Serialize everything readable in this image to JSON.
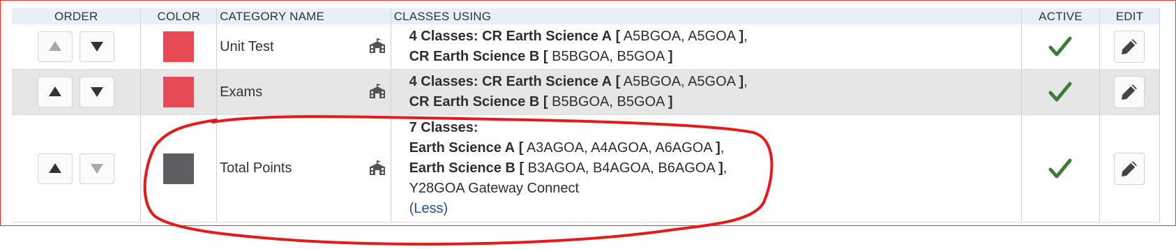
{
  "headers": {
    "order": "ORDER",
    "color": "COLOR",
    "category_name": "CATEGORY NAME",
    "classes_using": "CLASSES USING",
    "active": "ACTIVE",
    "edit": "EDIT"
  },
  "rows": [
    {
      "name": "Unit Test",
      "color": "#e64a55",
      "up_enabled": false,
      "down_enabled": true,
      "active": true,
      "classes": {
        "count": "4 Classes:",
        "lines": [
          {
            "course": "CR Earth Science A",
            "open": "[",
            "sections": "A5BGOA, A5GOA",
            "close": "]",
            "sep": ","
          },
          {
            "course": "CR Earth Science B",
            "open": "[",
            "sections": "B5BGOA, B5GOA",
            "close": "]",
            "sep": ""
          }
        ]
      }
    },
    {
      "name": "Exams",
      "color": "#e64a55",
      "up_enabled": true,
      "down_enabled": true,
      "active": true,
      "classes": {
        "count": "4 Classes:",
        "lines": [
          {
            "course": "CR Earth Science A",
            "open": "[",
            "sections": "A5BGOA, A5GOA",
            "close": "]",
            "sep": ","
          },
          {
            "course": "CR Earth Science B",
            "open": "[",
            "sections": "B5BGOA, B5GOA",
            "close": "]",
            "sep": ""
          }
        ]
      }
    },
    {
      "name": "Total Points",
      "color": "#5f5e62",
      "up_enabled": true,
      "down_enabled": false,
      "active": true,
      "classes": {
        "count": "7 Classes:",
        "lines": [
          {
            "course": "Earth Science A",
            "open": "[",
            "sections": "A3AGOA, A4AGOA, A6AGOA",
            "close": "]",
            "sep": ","
          },
          {
            "course": "Earth Science B",
            "open": "[",
            "sections": "B3AGOA, B4AGOA, B6AGOA",
            "close": "]",
            "sep": ","
          }
        ],
        "extra": "Y28GOA Gateway Connect",
        "less_link": "(Less)"
      }
    }
  ],
  "colors": {
    "header_bg": "#e7f0f7",
    "check": "#3a7d3a",
    "annotation": "#e31b1b",
    "link": "#1f4e8c"
  }
}
